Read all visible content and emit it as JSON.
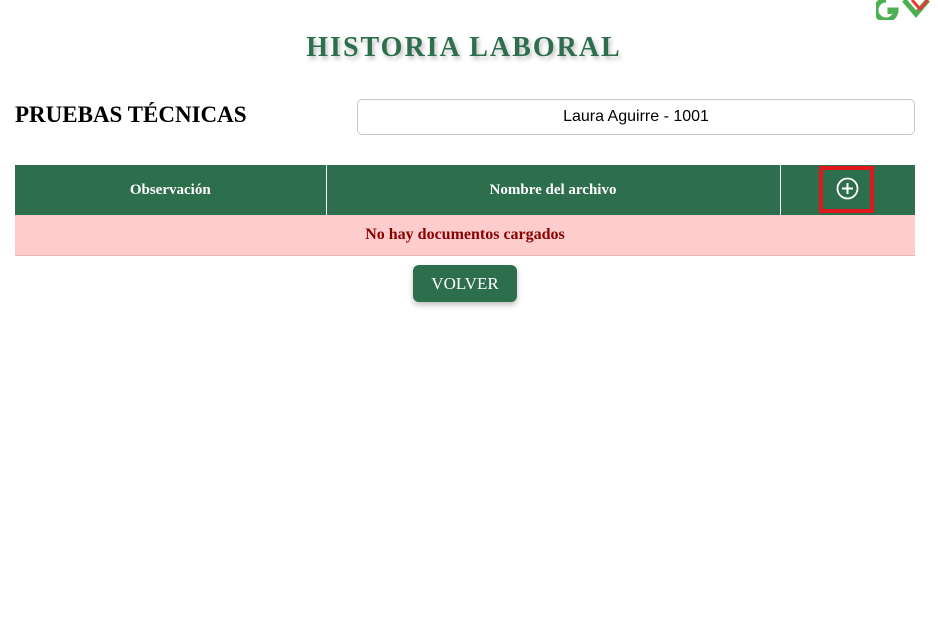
{
  "header": {
    "title": "HISTORIA LABORAL",
    "logo_icon": "brand-logo-icon"
  },
  "section": {
    "title": "PRUEBAS TÉCNICAS",
    "employee": "Laura Aguirre - 1001"
  },
  "table": {
    "columns": [
      "Observación",
      "Nombre del archivo"
    ],
    "add_icon": "plus-circle-icon",
    "empty_message": "No hay documentos cargados"
  },
  "actions": {
    "back_label": "VOLVER"
  },
  "colors": {
    "primary_green": "#2d6e4c",
    "empty_row_bg": "#fdcccc",
    "empty_row_text": "#8b0000",
    "highlight_red": "#e0181e"
  }
}
